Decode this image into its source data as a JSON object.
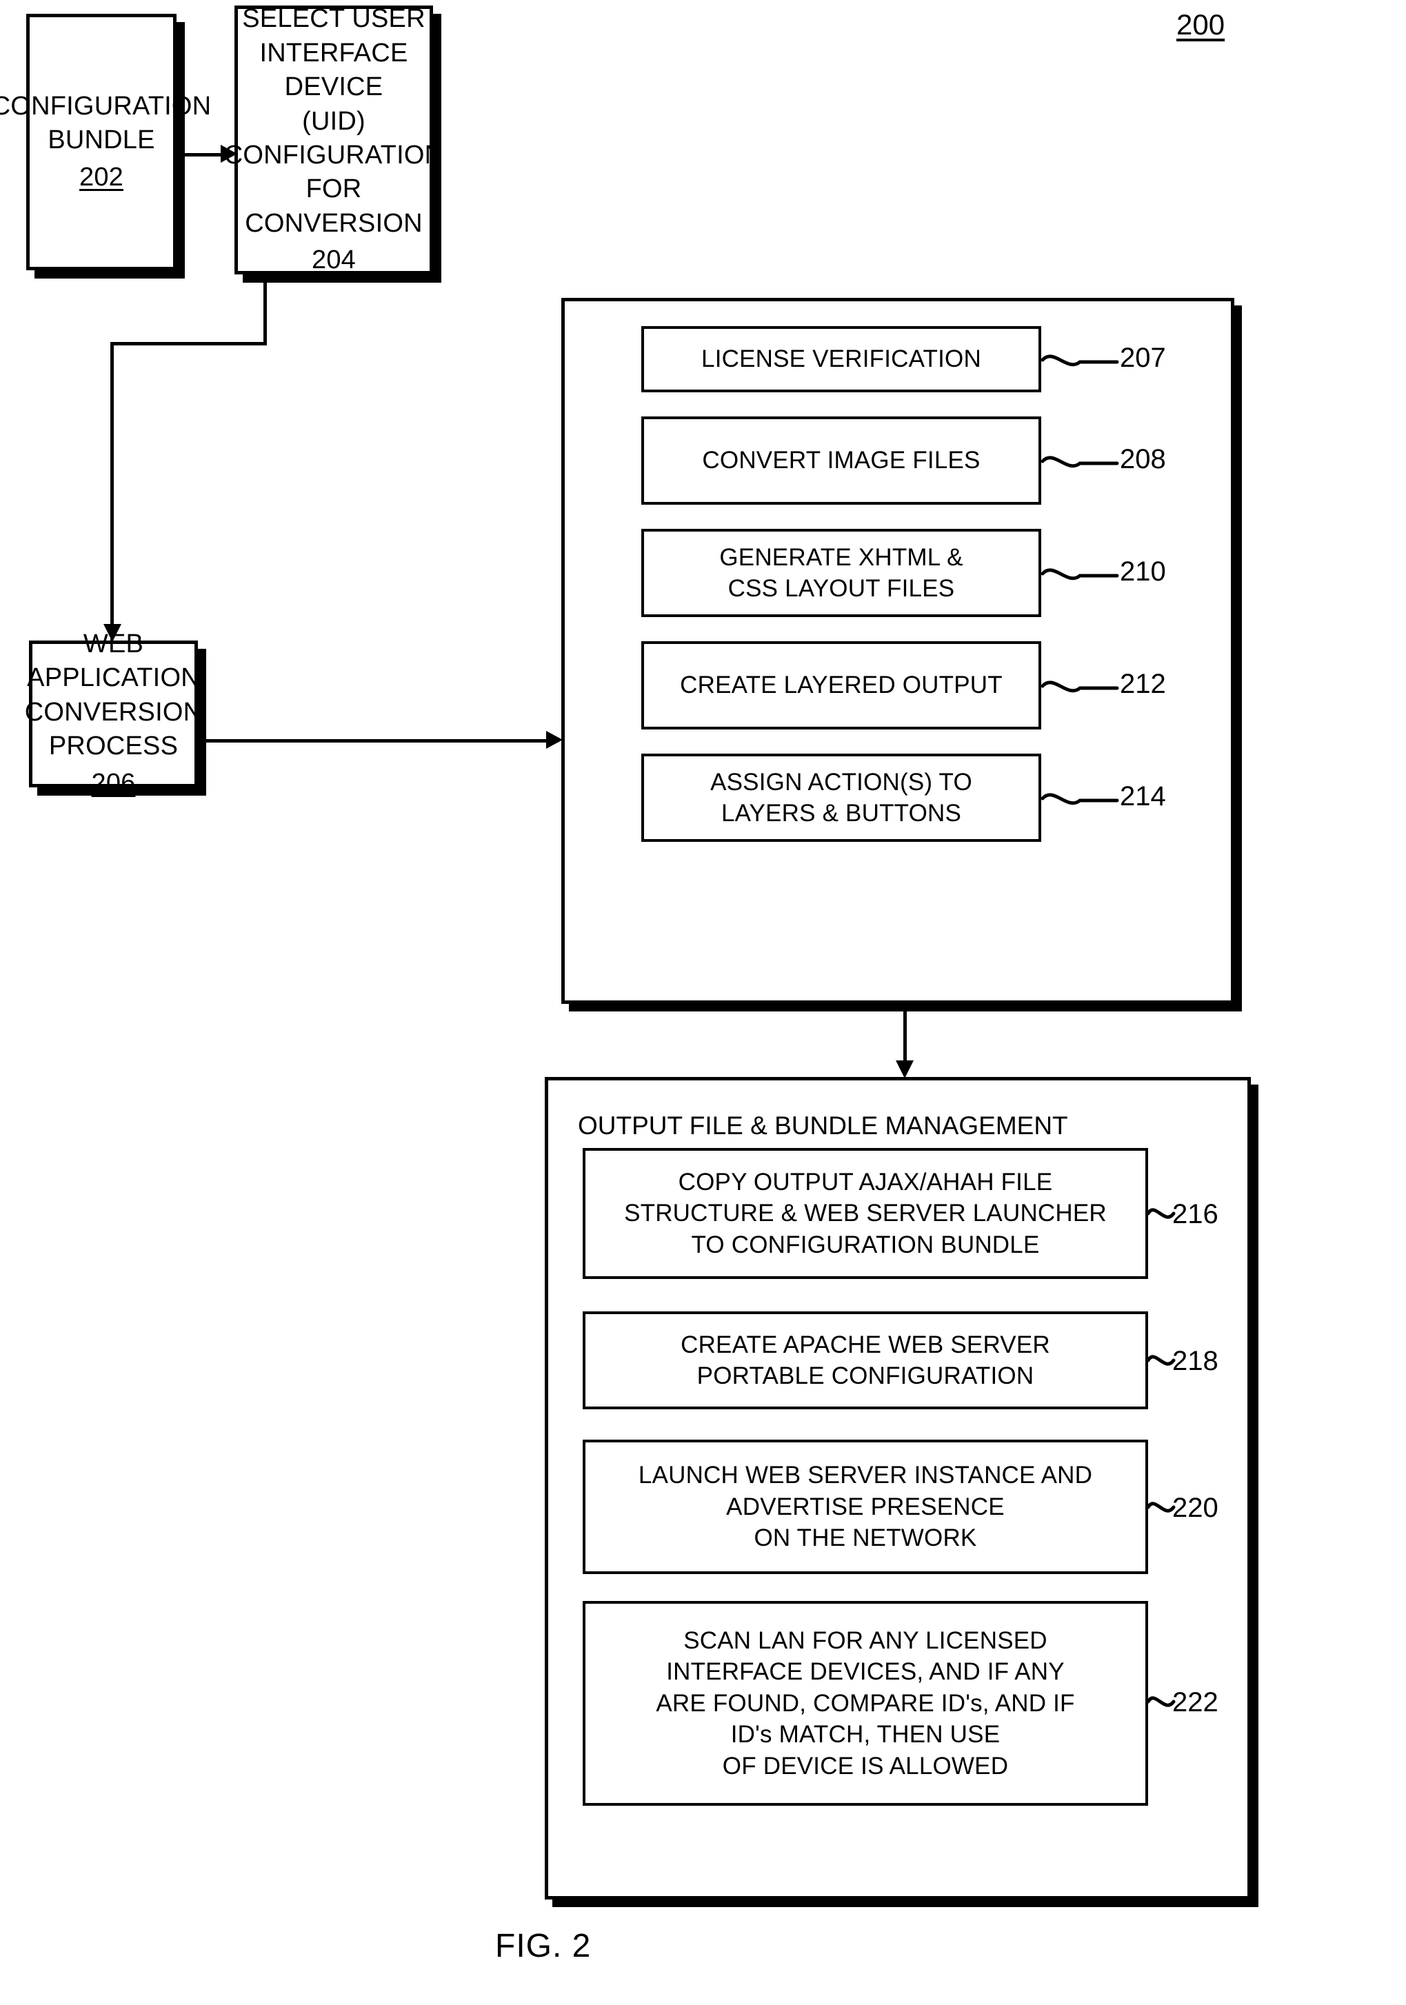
{
  "figure": {
    "id": "200",
    "caption": "FIG. 2"
  },
  "nodes": {
    "configuration_bundle": {
      "label": "CONFIGURATION\nBUNDLE",
      "ref": "202"
    },
    "select_uid": {
      "label": "SELECT USER\nINTERFACE DEVICE\n(UID) CONFIGURATION\nFOR CONVERSION",
      "ref": "204"
    },
    "conversion_process": {
      "label": "WEB APPLICATION\nCONVERSION\nPROCESS",
      "ref": "206"
    }
  },
  "conversion_panel": {
    "steps": [
      {
        "label": "LICENSE VERIFICATION",
        "ref": "207"
      },
      {
        "label": "CONVERT IMAGE FILES",
        "ref": "208"
      },
      {
        "label": "GENERATE XHTML &\nCSS LAYOUT FILES",
        "ref": "210"
      },
      {
        "label": "CREATE LAYERED OUTPUT",
        "ref": "212"
      },
      {
        "label": "ASSIGN ACTION(S) TO\nLAYERS & BUTTONS",
        "ref": "214"
      }
    ]
  },
  "output_panel": {
    "title": "OUTPUT FILE & BUNDLE MANAGEMENT",
    "steps": [
      {
        "label": "COPY OUTPUT AJAX/AHAH FILE\nSTRUCTURE & WEB SERVER LAUNCHER\nTO CONFIGURATION BUNDLE",
        "ref": "216"
      },
      {
        "label": "CREATE APACHE WEB SERVER\nPORTABLE CONFIGURATION",
        "ref": "218"
      },
      {
        "label": "LAUNCH WEB SERVER INSTANCE AND\nADVERTISE PRESENCE\nON THE NETWORK",
        "ref": "220"
      },
      {
        "label": "SCAN LAN FOR ANY LICENSED\nINTERFACE DEVICES, AND IF ANY\nARE FOUND, COMPARE ID's, AND IF\nID's MATCH, THEN USE\nOF DEVICE IS ALLOWED",
        "ref": "222"
      }
    ]
  },
  "colors": {
    "ink": "#000000",
    "paper": "#ffffff"
  }
}
